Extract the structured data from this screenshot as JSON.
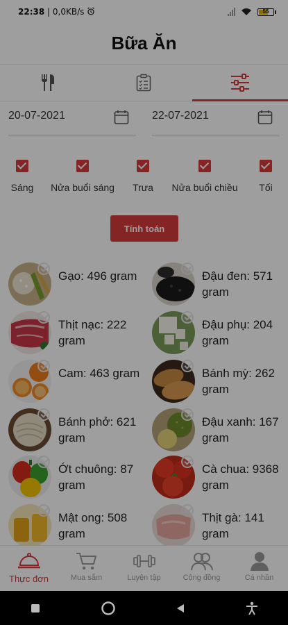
{
  "status_bar": {
    "time": "22:38",
    "network": "| 0,0KB/s",
    "battery": "55"
  },
  "header": {
    "title": "Bữa Ăn"
  },
  "tabs": [
    {
      "icon": "fork-knife-icon"
    },
    {
      "icon": "clipboard-icon"
    },
    {
      "icon": "sliders-icon",
      "active": true
    }
  ],
  "date_range": {
    "from": "20-07-2021",
    "to": "22-07-2021"
  },
  "meals": [
    {
      "label": "Sáng",
      "checked": true
    },
    {
      "label": "Nửa buổi sáng",
      "checked": true
    },
    {
      "label": "Trưa",
      "checked": true
    },
    {
      "label": "Nửa buổi chiều",
      "checked": true
    },
    {
      "label": "Tối",
      "checked": true
    }
  ],
  "calculate_button": "Tính toán",
  "foods": [
    {
      "name": "Gạo: 496 gram",
      "icon": "rice-image"
    },
    {
      "name": "Đậu đen: 571 gram",
      "icon": "black-beans-image"
    },
    {
      "name": "Thịt nạc: 222 gram",
      "icon": "lean-meat-image"
    },
    {
      "name": "Đậu phụ: 204 gram",
      "icon": "tofu-image"
    },
    {
      "name": "Cam: 463 gram",
      "icon": "orange-image"
    },
    {
      "name": "Bánh mỳ: 262 gram",
      "icon": "bread-image"
    },
    {
      "name": "Bánh phở: 621 gram",
      "icon": "pho-noodles-image"
    },
    {
      "name": "Đậu xanh: 167 gram",
      "icon": "mung-beans-image"
    },
    {
      "name": "Ớt chuông: 87 gram",
      "icon": "bell-pepper-image"
    },
    {
      "name": "Cà chua: 9368 gram",
      "icon": "tomato-image"
    },
    {
      "name": "Mật ong: 508 gram",
      "icon": "honey-image"
    },
    {
      "name": "Thịt gà: 141 gram",
      "icon": "chicken-image"
    }
  ],
  "bottom_nav": [
    {
      "label": "Thực đơn",
      "icon": "cloche-icon",
      "active": true
    },
    {
      "label": "Mua sắm",
      "icon": "cart-icon"
    },
    {
      "label": "Luyện tập",
      "icon": "dumbbell-icon"
    },
    {
      "label": "Cộng đồng",
      "icon": "community-icon"
    },
    {
      "label": "Cá nhân",
      "icon": "person-icon"
    }
  ],
  "colors": {
    "accent": "#d63b3b",
    "text": "#222222",
    "muted": "#9a9a9a"
  }
}
